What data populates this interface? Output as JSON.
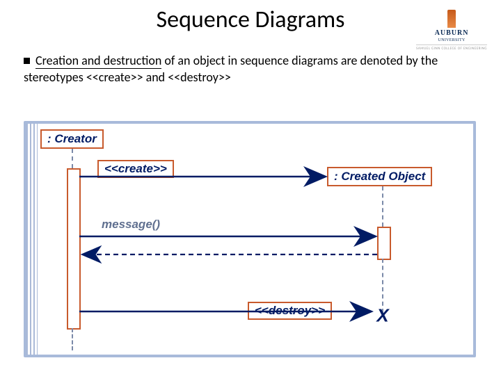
{
  "title": "Sequence Diagrams",
  "university": {
    "name": "AUBURN",
    "sub": "UNIVERSITY",
    "college": "SAMUEL GINN COLLEGE OF ENGINEERING"
  },
  "bullet": {
    "emph": "Creation and destruction",
    "rest": " of an object in sequence diagrams are denoted by the stereotypes <<create>> and <<destroy>>"
  },
  "diagram": {
    "creator": ": Creator",
    "created": ": Created Object",
    "create_msg": "<<create>>",
    "destroy_msg": "<<destroy>>",
    "call_msg": "message()",
    "terminator": "X"
  }
}
